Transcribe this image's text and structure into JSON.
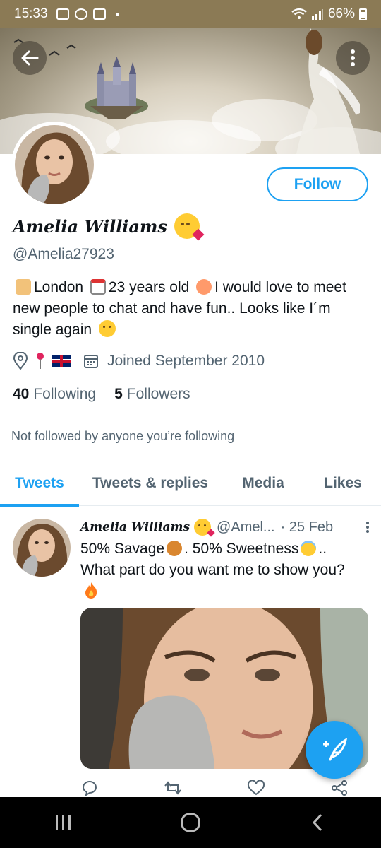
{
  "status_bar": {
    "time": "15:33",
    "battery": "66%"
  },
  "profile": {
    "name": "Amelia Williams",
    "handle": "@Amelia27923",
    "follow_label": "Follow",
    "bio_parts": [
      "London",
      "23 years old",
      "I would love to meet new people to chat and have fun.. Looks like I´m single again"
    ],
    "joined": "Joined September 2010",
    "following_count": "40",
    "following_label": "Following",
    "followers_count": "5",
    "followers_label": "Followers",
    "not_followed": "Not followed by anyone you’re following"
  },
  "tabs": [
    "Tweets",
    "Tweets & replies",
    "Media",
    "Likes"
  ],
  "tweet": {
    "name": "Amelia Williams",
    "handle": "@Amel...",
    "date": "· 25 Feb",
    "text_1": "50% Savage",
    "text_2": ". 50% Sweetness",
    "text_3": "..",
    "text_4": "What part do you want me to show you?"
  },
  "colors": {
    "accent": "#1da1f2",
    "text": "#0f1419",
    "muted": "#536471",
    "status_bar": "#8b7a55"
  },
  "icons": {
    "back": "arrow-left-icon",
    "more": "more-vertical-icon",
    "location": "location-icon",
    "calendar": "calendar-icon",
    "compose": "compose-tweet-icon"
  }
}
